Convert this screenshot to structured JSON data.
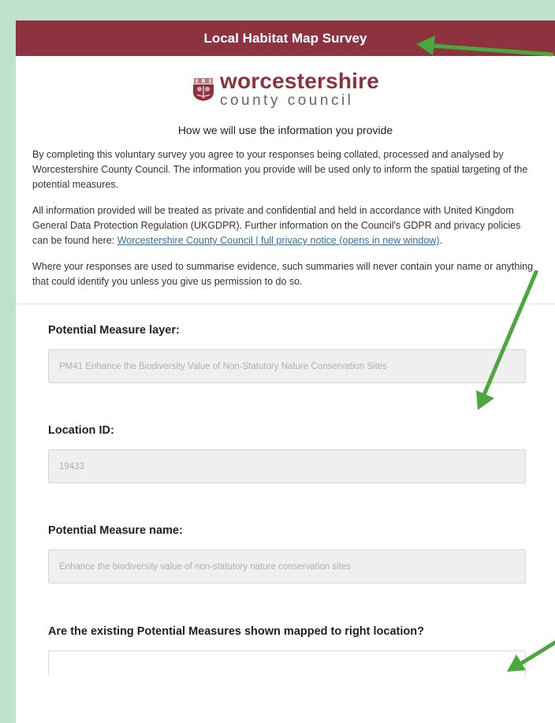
{
  "header": {
    "title": "Local Habitat Map Survey"
  },
  "logo": {
    "line1": "worcestershire",
    "line2": "county council"
  },
  "intro": {
    "heading": "How we will use the information you provide",
    "p1": "By completing this voluntary survey you agree to your responses being collated, processed and analysed by Worcestershire County Council. The information you provide will be used only to inform the spatial targeting of the potential measures.",
    "p2_text": "All information provided will be treated as private and confidential and held in accordance with United Kingdom General Data Protection Regulation (UKGDPR). Further information on the Council's GDPR and privacy policies can be found here: ",
    "p2_link": "Worcestershire County Council | full privacy notice (opens in new window)",
    "p2_end": ".",
    "p3": "Where your responses are used to summarise evidence, such summaries will never contain your name or anything that could identify you unless you give us permission to do so."
  },
  "fields": {
    "layer": {
      "label": "Potential Measure layer:",
      "value": "PM41 Enhance the Biodiversity Value of Non-Statutory Nature Conservation Sites"
    },
    "location": {
      "label": "Location ID:",
      "value": "19433"
    },
    "name": {
      "label": "Potential Measure name:",
      "value": "Enhance the biodiversity value of non-statutory nature conservation sites"
    },
    "question": {
      "label": "Are the existing Potential Measures shown mapped to right location?"
    }
  },
  "colors": {
    "header": "#8d3340",
    "background": "#bfe2cf",
    "arrow": "#4aa83c",
    "link": "#2a6fb5"
  },
  "icons": {
    "logo": "county-crest-icon",
    "arrows": "green-arrow-icon"
  }
}
